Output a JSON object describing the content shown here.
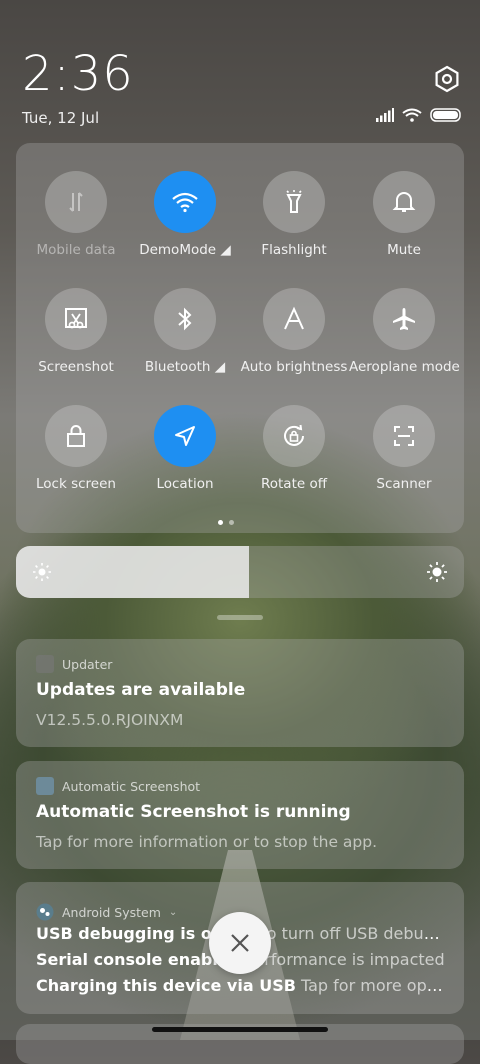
{
  "status": {
    "time": "2:36",
    "date": "Tue, 12 Jul"
  },
  "toggles": [
    {
      "label": "Mobile data",
      "icon": "mobile-data-icon",
      "state": "disabled"
    },
    {
      "label": "DemoMode ◢",
      "icon": "wifi-icon",
      "state": "on"
    },
    {
      "label": "Flashlight",
      "icon": "flashlight-icon",
      "state": "off"
    },
    {
      "label": "Mute",
      "icon": "bell-icon",
      "state": "off"
    },
    {
      "label": "Screenshot",
      "icon": "screenshot-icon",
      "state": "off"
    },
    {
      "label": "Bluetooth ◢",
      "icon": "bluetooth-icon",
      "state": "off"
    },
    {
      "label": "Auto brightness",
      "icon": "auto-brightness-icon",
      "state": "off"
    },
    {
      "label": "Aeroplane mode",
      "icon": "airplane-icon",
      "state": "off"
    },
    {
      "label": "Lock screen",
      "icon": "lock-icon",
      "state": "off"
    },
    {
      "label": "Location",
      "icon": "location-icon",
      "state": "on"
    },
    {
      "label": "Rotate off",
      "icon": "rotate-lock-icon",
      "state": "off"
    },
    {
      "label": "Scanner",
      "icon": "scanner-icon",
      "state": "off"
    }
  ],
  "brightness": {
    "level": 0.52
  },
  "notifications": {
    "updater": {
      "app": "Updater",
      "title": "Updates are available",
      "body": "V12.5.5.0.RJOINXM"
    },
    "screenshot": {
      "app": "Automatic Screenshot",
      "title": "Automatic Screenshot is running",
      "body": "Tap for more information or to stop the app."
    },
    "system": {
      "app": "Android System",
      "line1_title": "USB debugging is on",
      "line1_body": "Tap to turn off USB debugging",
      "line2_title": "Serial console enabled",
      "line2_body": "Performance is impacted",
      "line3_title": "Charging this device via USB",
      "line3_body": "Tap for more options"
    }
  },
  "colors": {
    "accent": "#1e8ff2",
    "panel": "rgba(170,170,170,0.35)"
  }
}
